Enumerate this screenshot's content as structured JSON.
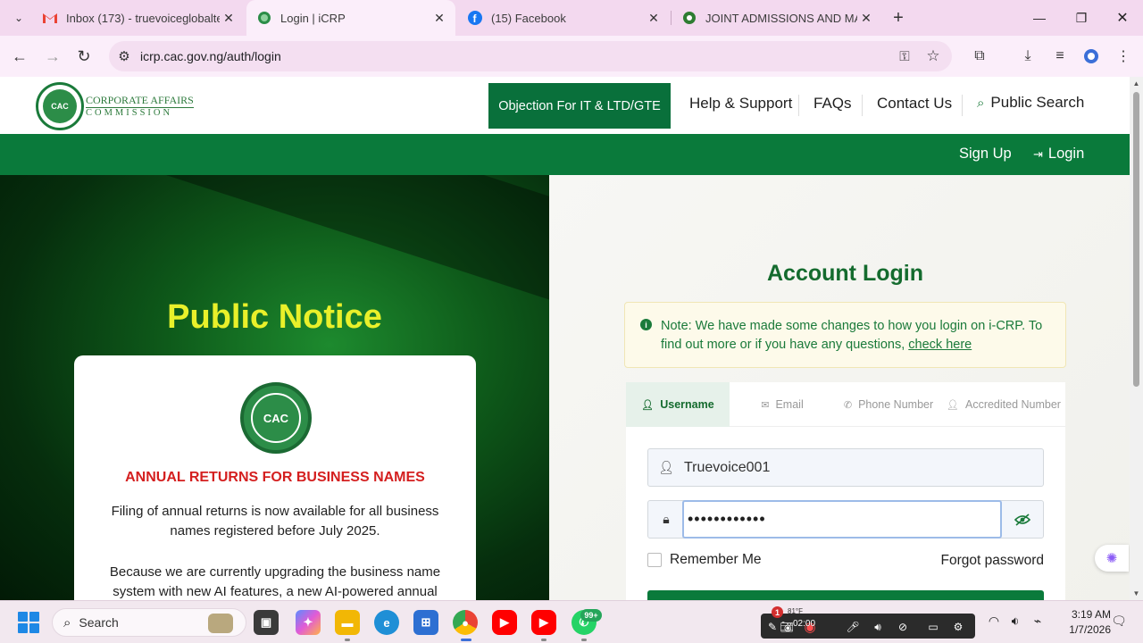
{
  "browser": {
    "tabs": [
      {
        "title": "Inbox (173) - truevoiceglobalte",
        "icon": "gmail-icon"
      },
      {
        "title": "Login | iCRP",
        "icon": "cac-favicon-icon"
      },
      {
        "title": "(15) Facebook",
        "icon": "facebook-icon"
      },
      {
        "title": "JOINT ADMISSIONS AND MATR",
        "icon": "jamb-favicon-icon"
      }
    ],
    "url": "icrp.cac.gov.ng/auth/login"
  },
  "site": {
    "logo_line1": "CORPORATE AFFAIRS",
    "logo_line2": "COMMISSION",
    "logo_seal": "CAC",
    "nav": {
      "objection": "Objection For IT & LTD/GTE",
      "help": "Help & Support",
      "faqs": "FAQs",
      "contact": "Contact Us",
      "public_search": "Public Search"
    },
    "greenbar": {
      "signup": "Sign Up",
      "login": "Login"
    }
  },
  "notice": {
    "title": "Public Notice",
    "seal_text": "CAC",
    "heading": "ANNUAL RETURNS FOR BUSINESS NAMES",
    "p1": "Filing of annual returns is now available for all business names registered before July 2025.",
    "p2": "Because we are currently upgrading the business name system with new AI features, a new AI-powered annual"
  },
  "login": {
    "title": "Account Login",
    "note_text": "Note: We have made some changes to how you login on i-CRP. To find out more or if you have any questions,",
    "note_link": "check here",
    "tabs": [
      "Username",
      "Email",
      "Phone Number",
      "Accredited Number"
    ],
    "username_value": "Truevoice001",
    "password_mask": "••••••••••••",
    "remember_label": "Remember Me",
    "forgot_label": "Forgot password"
  },
  "taskbar": {
    "search_label": "Search",
    "whatsapp_badge": "99+",
    "notif_badge": "1",
    "weather": "81°F",
    "recording_time": "02:00",
    "clock_time": "3:19 AM",
    "clock_date": "1/7/2026"
  },
  "colors": {
    "brand_green": "#0a7a3b",
    "notice_yellow": "#e9f02a",
    "heading_red": "#d41f1f"
  }
}
